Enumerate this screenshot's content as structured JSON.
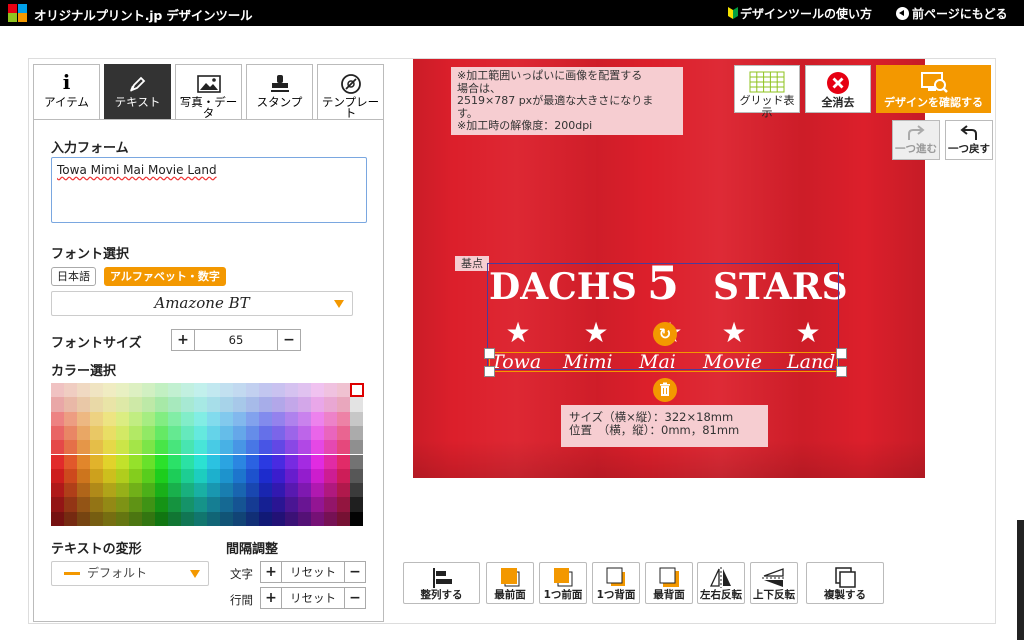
{
  "header": {
    "brand": "オリジナルプリント.jp  デザインツール",
    "help_link": "デザインツールの使い方",
    "back_link": "前ページにもどる"
  },
  "tabs": [
    {
      "label": "アイテム",
      "icon": "info-icon"
    },
    {
      "label": "テキスト",
      "icon": "pen-icon"
    },
    {
      "label": "写真・データ",
      "icon": "image-icon"
    },
    {
      "label": "スタンプ",
      "icon": "stamp-icon"
    },
    {
      "label": "テンプレート",
      "icon": "template-icon"
    }
  ],
  "text_panel": {
    "input_title": "入力フォーム",
    "input_value": "Towa  Mimi  Mai  Movie  Land",
    "font_title": "フォント選択",
    "font_tab_japanese": "日本語",
    "font_tab_alphabet": "アルファベット・数字",
    "font_selected": "Amazone BT",
    "font_size_title": "フォントサイズ",
    "font_size_value": "65",
    "color_title": "カラー選択",
    "transform_title": "テキストの変形",
    "transform_value": "デフォルト",
    "spacing_title": "間隔調整",
    "char_label": "文字",
    "line_label": "行間",
    "reset_label": "リセット",
    "plus": "+",
    "minus": "−"
  },
  "canvas": {
    "note_lines": [
      "※加工範囲いっぱいに画像を配置する",
      "場合は、",
      "2519×787 pxが最適な大きさになりま",
      "す。",
      "※加工時の解像度：200dpi"
    ],
    "base_label": "基点",
    "design_title_left": "DACHS",
    "design_number": "5",
    "design_title_right": "STARS",
    "names": [
      "Towa",
      "Mimi",
      "Mai",
      "Movie",
      "Land"
    ],
    "size_line1": "サイズ（横×縦）：322×18mm",
    "size_line2": "位置　（横，縦）：0mm，81mm",
    "shirt_color": "#dc1f2b",
    "accent_color": "#f39800"
  },
  "toolbar": {
    "grid": "グリッド表示",
    "clear": "全消去",
    "confirm": "デザインを確認する",
    "redo": "一つ進む",
    "undo": "一つ戻す"
  },
  "bottom_toolbar": {
    "align": "整列する",
    "front": "最前面",
    "forward": "1つ前面",
    "backward": "1つ背面",
    "back": "最背面",
    "flip_h": "左右反転",
    "flip_v": "上下反転",
    "duplicate": "複製する"
  }
}
